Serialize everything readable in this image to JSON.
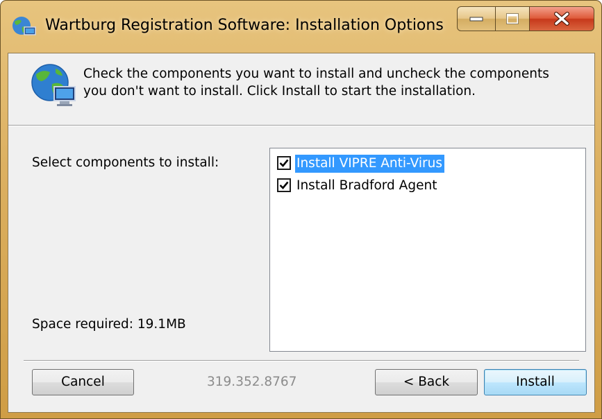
{
  "window": {
    "title": "Wartburg Registration Software: Installation Options",
    "app_icon": "globe-network-icon",
    "caption_icons": [
      "minimize-icon",
      "maximize-icon",
      "close-icon"
    ]
  },
  "header": {
    "icon": "globe-computer-icon",
    "instructions": "Check the components you want to install and uncheck the components you don't want to install. Click Install to start the installation."
  },
  "components": {
    "label": "Select components to install:",
    "items": [
      {
        "label": "Install VIPRE Anti-Virus",
        "checked": true,
        "selected": true
      },
      {
        "label": "Install Bradford Agent",
        "checked": true,
        "selected": false
      }
    ],
    "space_required": "Space required: 19.1MB"
  },
  "footer": {
    "cancel_label": "Cancel",
    "branding_text": "319.352.8767",
    "back_label": "< Back",
    "install_label": "Install"
  },
  "colors": {
    "frame": "#dcb061",
    "selection": "#3399ff",
    "close_button": "#c7391b"
  }
}
